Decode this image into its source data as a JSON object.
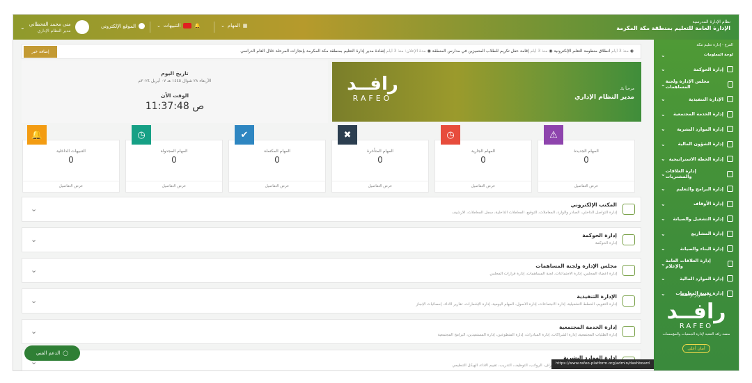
{
  "topbar": {
    "user_name": "منى محمد القحطاني",
    "user_role": "مدير النظام الإداري",
    "portal": "الموقع الإلكتروني",
    "notifications": "التنبيهات",
    "notifications_count": "3",
    "messages": "المهام",
    "brand_line1": "نظام الإدارة المدرسية",
    "brand_line2": "الإدارة العامة للتعليم بمنطقة مكة المكرمة",
    "brand_line3": "الفرع - إدارة تعليم مكة"
  },
  "ticker": {
    "button": "إضافة خبر",
    "item1": "إشادة مدير إدارة التعليم بمنطقة مكة المكرمة بإنجازات المرحلة خلال العام الدراسي",
    "item1_meta": "مدة الإعلان: منذ 3 أيام",
    "item2": "إقامة حفل تكريم للطلاب المتميزين في مدارس المنطقة",
    "item2_meta": "منذ 3 أيام",
    "item3": "انطلاق منظومة التعلم الإلكترونية",
    "item3_meta": "منذ 3 أيام"
  },
  "datecard": {
    "date_label": "تاريخ اليوم",
    "date_value": "الأربعاء ٢٨ شوال ١٤٤٥ هـ ٠٧ أبريل ٢٠٢٤م",
    "time_label": "الوقت الآن",
    "time_value": "11:37:48 ص"
  },
  "rolecard": {
    "logo_ar": "رافــد",
    "logo_en": "RAFEO",
    "small": "مرحباً بك",
    "title": "مدير النظام الإداري"
  },
  "stats": [
    {
      "label": "المهام الجديدة",
      "value": "0",
      "more": "عرض التفاصيل",
      "color": "#8e44ad",
      "icon": "warning-icon",
      "glyph": "⚠"
    },
    {
      "label": "المهام الجارية",
      "value": "0",
      "more": "عرض التفاصيل",
      "color": "#e74c3c",
      "icon": "clock-icon",
      "glyph": "◷"
    },
    {
      "label": "المهام المتأخرة",
      "value": "0",
      "more": "عرض التفاصيل",
      "color": "#2c3e50",
      "icon": "close-circle-icon",
      "glyph": "✖"
    },
    {
      "label": "المهام المكتملة",
      "value": "0",
      "more": "عرض التفاصيل",
      "color": "#2e86c1",
      "icon": "check-circle-icon",
      "glyph": "✔"
    },
    {
      "label": "المهام المجدولة",
      "value": "0",
      "more": "عرض التفاصيل",
      "color": "#16a085",
      "icon": "clock-icon",
      "glyph": "◷"
    },
    {
      "label": "التنبيهات الداخلية",
      "value": "0",
      "more": "عرض التفاصيل",
      "color": "#f39c12",
      "icon": "bell-icon",
      "glyph": "🔔"
    }
  ],
  "accordion": [
    {
      "title": "المكتب الإلكتروني",
      "desc": "إدارة التواصل الداخلي، الصادر والوارد، المعاملات، التوقيع، المعاملات الداخلية، سجل المعاملات، الأرشيف"
    },
    {
      "title": "إدارة الحوكمة",
      "desc": "إدارة الحوكمة"
    },
    {
      "title": "مجلس الإدارة ولجنة المساهمات",
      "desc": "إدارة أعضاء المجلس، إدارة الاجتماعات، لجنة المساهمات، إدارة قرارات المجلس"
    },
    {
      "title": "الإدارة التنفيذية",
      "desc": "إدارة التقويم، الخطط التشغيلية، إدارة الاجتماعات، إدارة الأصول، المهام اليومية، إدارة الإشعارات، تقارير الأداء، إحصائيات الإنجاز"
    },
    {
      "title": "إدارة الخدمة المجتمعية",
      "desc": "إدارة الطلبات المجتمعية، إدارة الشراكات، إدارة المبادرات، إدارة المتطوعين، إدارة المستفيدين، البرامج المجتمعية"
    },
    {
      "title": "إدارة الموارد البشرية",
      "desc": "إدارة الموظفين، الإجازات، الحضور والانصراف، الرواتب، التوظيف، التدريب، تقييم الأداء، الهيكل التنظيمي"
    }
  ],
  "sidebar": {
    "sub": "لوحة المعلومات",
    "items": [
      "إدارة الحوكمة",
      "مجلس الإدارة ولجنة المساهمات",
      "الإدارة التنفيذية",
      "إدارة الخدمة المجتمعية",
      "إدارة الموارد البشرية",
      "إدارة الشؤون المالية",
      "إدارة الخطة الاستراتيجية",
      "إدارة العلاقات والمشتريات",
      "إدارة البرامج والتعليم",
      "إدارة الأوقاف",
      "إدارة التشغيل والصيانة",
      "إدارة المشاريع",
      "إدارة البناء والصيانة",
      "إدارة العلاقات العامة والإعلام",
      "إدارة الموارد المالية",
      "إدارة تقنية المعلومات"
    ],
    "powered": "تم التطوير بواسطة",
    "logo_ar": "رافــد",
    "logo_en": "RAFEO",
    "desc": "منصة رافد التقنية لإدارة الجمعيات والمؤسسات",
    "badge": "أمان أعلى"
  },
  "support": {
    "label": "الدعم الفني"
  },
  "statusbar": {
    "url": "https://www.rafeo-platform.org/admin/dashboard"
  }
}
